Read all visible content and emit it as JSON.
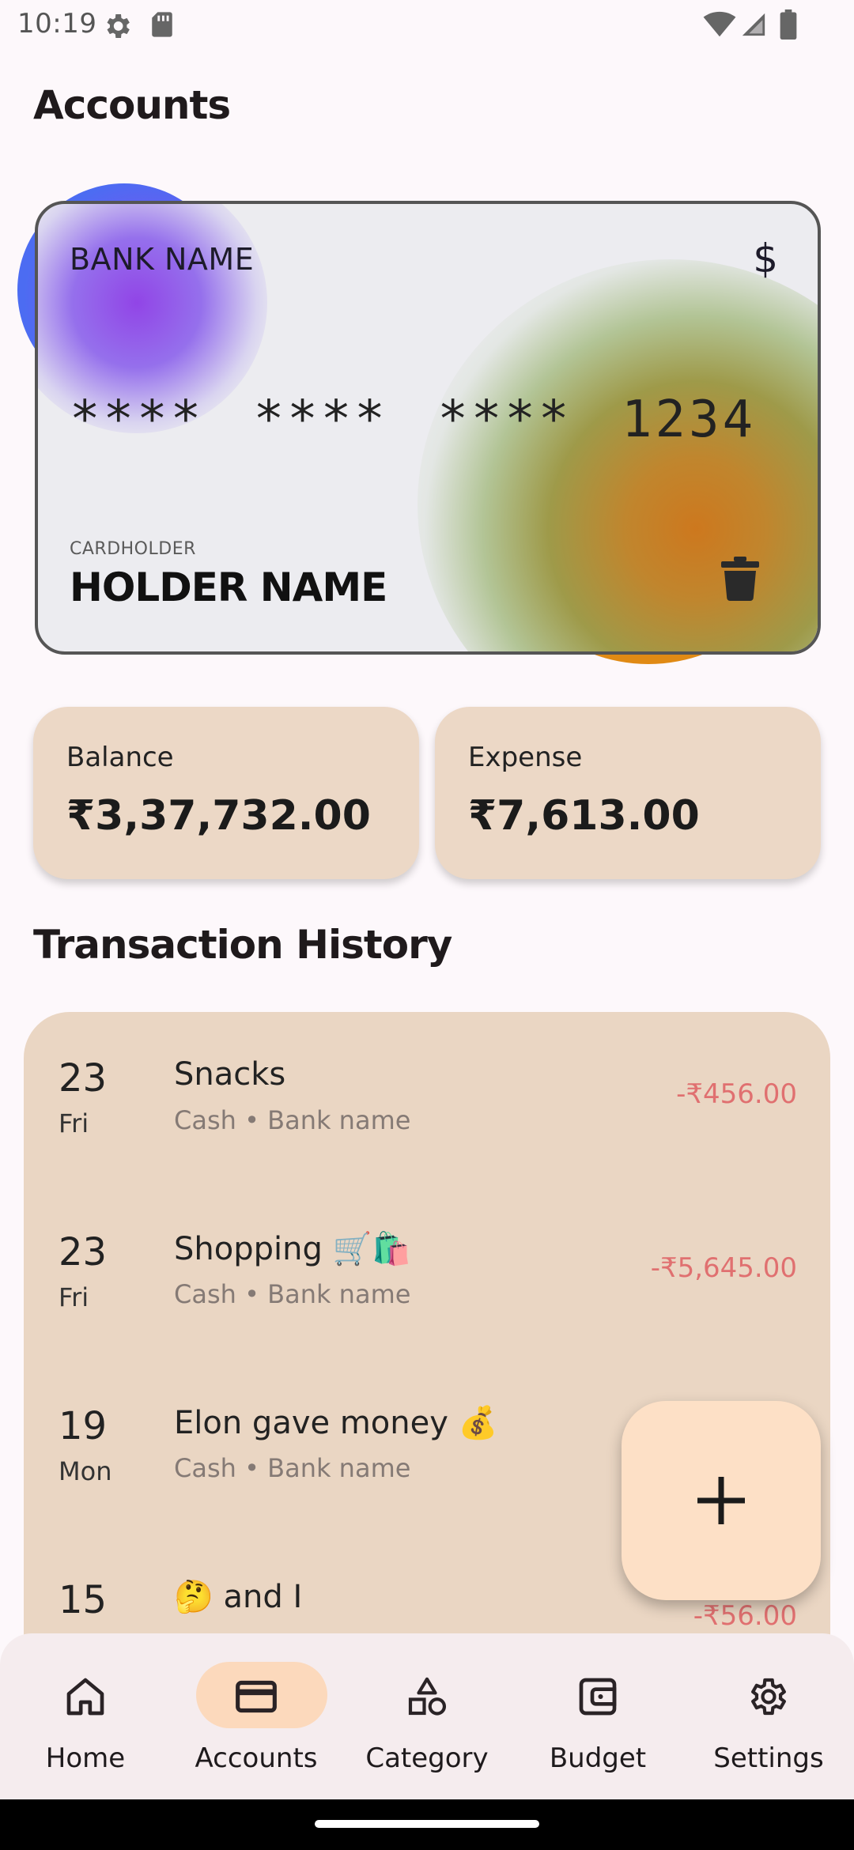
{
  "status_bar": {
    "time": "10:19"
  },
  "page_title": "Accounts",
  "card": {
    "bank_name": "BANK NAME",
    "currency_symbol": "$",
    "number": "****  ****  ****  1234",
    "cardholder_label": "CARDHOLDER",
    "holder_name": "HOLDER NAME"
  },
  "summary": {
    "balance_label": "Balance",
    "balance_value": "₹3,37,732.00",
    "expense_label": "Expense",
    "expense_value": "₹7,613.00"
  },
  "history_title": "Transaction History",
  "transactions": [
    {
      "day": "23",
      "weekday": "Fri",
      "title": "Snacks",
      "subtitle": "Cash • Bank name",
      "amount": "-₹456.00"
    },
    {
      "day": "23",
      "weekday": "Fri",
      "title": "Shopping 🛒🛍️",
      "subtitle": "Cash • Bank name",
      "amount": "-₹5,645.00"
    },
    {
      "day": "19",
      "weekday": "Mon",
      "title": "Elon gave money 💰",
      "subtitle": "Cash • Bank name",
      "amount": "+₹"
    },
    {
      "day": "15",
      "weekday": "",
      "title": "🤔 and I",
      "subtitle": "",
      "amount": "-₹56.00"
    }
  ],
  "fab": {
    "icon": "plus-icon"
  },
  "nav": {
    "items": [
      {
        "label": "Home",
        "icon": "home-icon",
        "active": false
      },
      {
        "label": "Accounts",
        "icon": "credit-card-icon",
        "active": true
      },
      {
        "label": "Category",
        "icon": "category-shapes-icon",
        "active": false
      },
      {
        "label": "Budget",
        "icon": "wallet-icon",
        "active": false
      },
      {
        "label": "Settings",
        "icon": "gear-icon",
        "active": false
      }
    ]
  },
  "colors": {
    "accent_pill": "#fcd9bc",
    "summary_card": "#ecd8c6",
    "panel": "#ead6c3",
    "expense_red": "#e07070",
    "income_green": "#4caf50"
  }
}
